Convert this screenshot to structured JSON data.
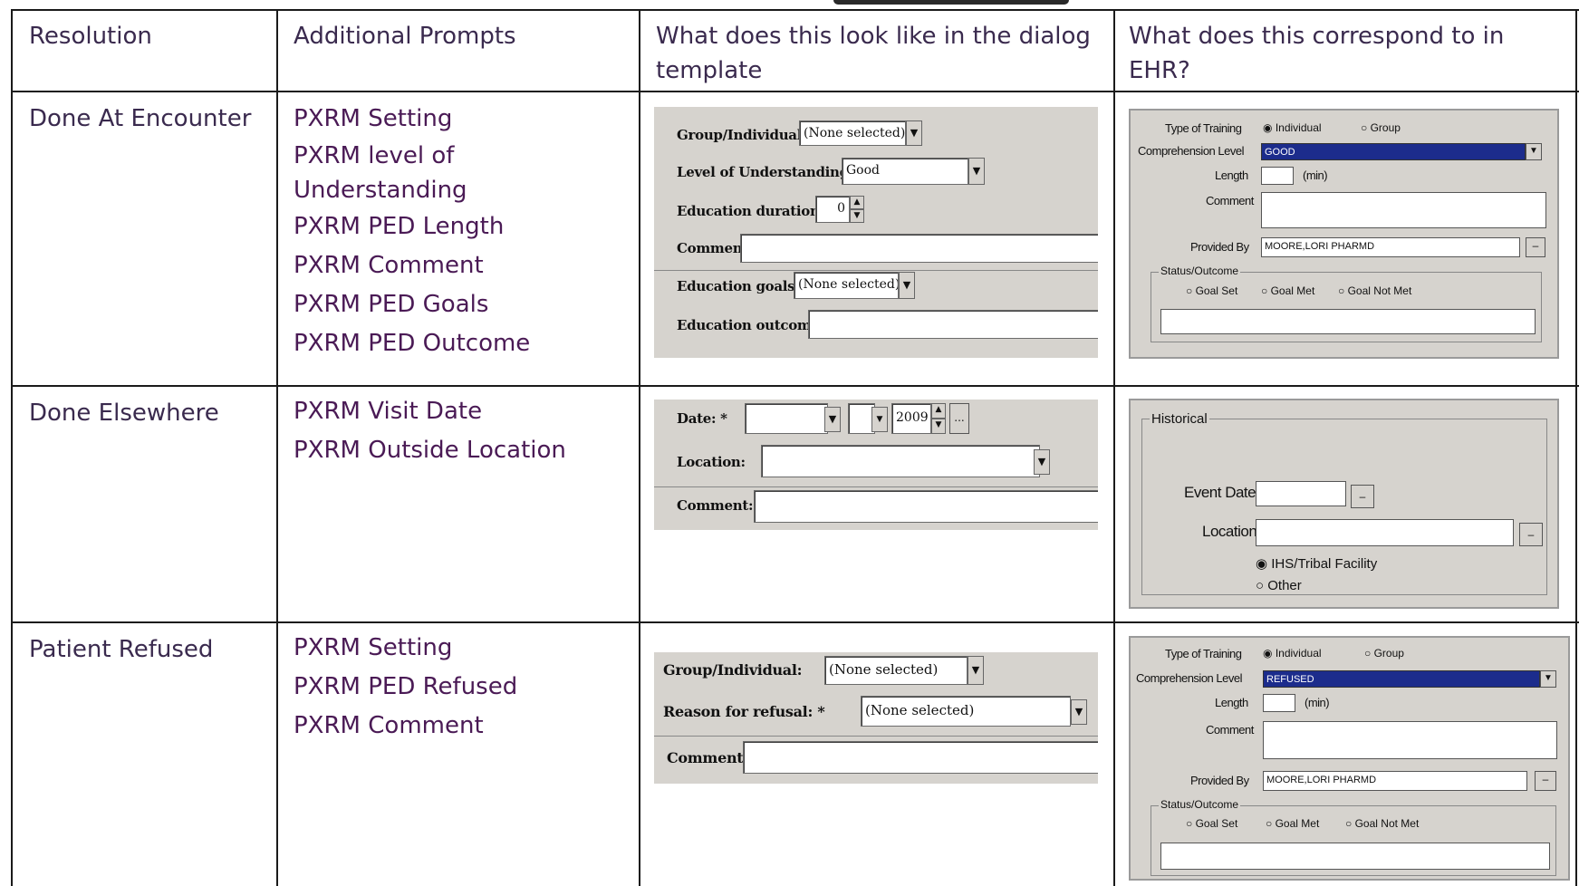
{
  "headers": [
    "Resolution",
    "Additional Prompts",
    "What does this look like in the dialog template",
    "What does this correspond to in EHR?"
  ],
  "header_lines": {
    "c3": [
      "What does this look like in the dialog",
      "template"
    ],
    "c4": [
      "What does this correspond to in",
      "EHR?"
    ]
  },
  "rows": [
    {
      "resolution": "Done At Encounter",
      "prompts": [
        "PXRM Setting",
        "PXRM level of",
        "Understanding",
        "PXRM PED Length",
        "PXRM Comment",
        "PXRM PED Goals",
        "PXRM PED Outcome"
      ],
      "dialog": {
        "group_label": "Group/Individual:",
        "group_value": "(None selected)",
        "level_label": "Level of Understanding:",
        "level_value": "Good",
        "duration_label": "Education duration:",
        "duration_value": "0",
        "comment_label": "Comment:",
        "goals_label": "Education goals:",
        "goals_value": "(None selected)",
        "outcome_label": "Education outcome:"
      },
      "ehr": {
        "type_label": "Type of Training",
        "radio_individual": "Individual",
        "radio_group": "Group",
        "comprehension_label": "Comprehension Level",
        "comprehension_value": "GOOD",
        "length_label": "Length",
        "length_unit": "(min)",
        "comment_label": "Comment",
        "provided_label": "Provided By",
        "provided_value": "MOORE,LORI PHARMD",
        "status_label": "Status/Outcome",
        "goal_set": "Goal Set",
        "goal_met": "Goal Met",
        "goal_not_met": "Goal Not Met"
      }
    },
    {
      "resolution": "Done Elsewhere",
      "prompts": [
        "PXRM Visit Date",
        "PXRM Outside Location"
      ],
      "dialog": {
        "date_label": "Date: *",
        "year_value": "2009",
        "location_label": "Location:",
        "comment_label": "Comment:"
      },
      "ehr": {
        "group_title": "Historical",
        "event_date_label": "Event Date",
        "location_label": "Location",
        "radio_ihs": "IHS/Tribal Facility",
        "radio_other": "Other"
      }
    },
    {
      "resolution": "Patient Refused",
      "prompts": [
        "PXRM Setting",
        "PXRM PED Refused",
        "PXRM Comment"
      ],
      "dialog": {
        "group_label": "Group/Individual:",
        "group_value": "(None selected)",
        "reason_label": "Reason for refusal: *",
        "reason_value": "(None selected)",
        "comment_label": "Comment:"
      },
      "ehr": {
        "type_label": "Type of Training",
        "radio_individual": "Individual",
        "radio_group": "Group",
        "comprehension_label": "Comprehension Level",
        "comprehension_value": "REFUSED",
        "length_label": "Length",
        "length_unit": "(min)",
        "comment_label": "Comment",
        "provided_label": "Provided By",
        "provided_value": "MOORE,LORI PHARMD",
        "status_label": "Status/Outcome",
        "goal_set": "Goal Set",
        "goal_met": "Goal Met",
        "goal_not_met": "Goal Not Met"
      }
    }
  ],
  "icons": {
    "dropdown": "▼",
    "spin_up": "▲",
    "spin_down": "▼",
    "ellipsis": "...",
    "radio_on": "◉",
    "radio_off": "○"
  }
}
